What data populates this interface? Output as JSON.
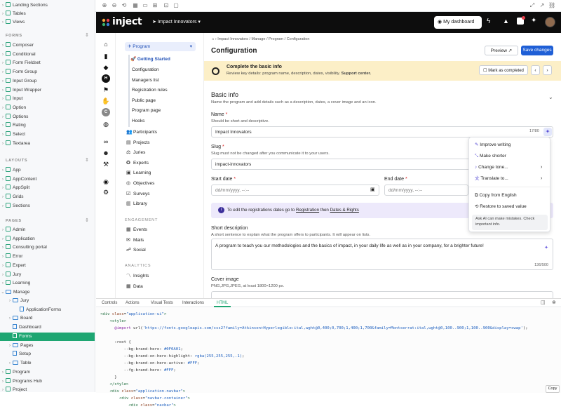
{
  "tree": {
    "top_items": [
      "Landing Sections",
      "Tables",
      "Views"
    ],
    "forms_label": "FORMS",
    "forms": [
      "Composer",
      "Conditional",
      "Form Fieldset",
      "Form Group",
      "Input Group",
      "Input Wrapper",
      "Input",
      "Option",
      "Options",
      "Rating",
      "Select",
      "Textarea"
    ],
    "layouts_label": "LAYOUTS",
    "layouts": [
      "App",
      "AppContent",
      "AppSplit",
      "Grids",
      "Sections"
    ],
    "pages_label": "PAGES",
    "pages": [
      "Admin",
      "Application",
      "Consulting portal",
      "Error",
      "Expert",
      "Jury",
      "Learning"
    ],
    "manage": "Manage",
    "manage_children": [
      "Jury",
      "ApplicationForms",
      "Board",
      "Dashboard",
      "Forms",
      "Pages",
      "Setup",
      "Table"
    ],
    "after": [
      "Program",
      "Programs Hub",
      "Project"
    ]
  },
  "navbar": {
    "brand": "inject",
    "program": "Impact Innovators",
    "dashboard": "My dashboard"
  },
  "menu": {
    "program": "Program",
    "getting_started": "🚀 Getting Started",
    "sub": [
      "Configuration",
      "Managers list",
      "Registration rules",
      "Public page",
      "Program page",
      "Hooks"
    ],
    "items": [
      "Participants",
      "Projects",
      "Juries",
      "Experts",
      "Learning",
      "Objectives",
      "Surveys",
      "Library"
    ],
    "engagement_label": "ENGAGEMENT",
    "engagement": [
      "Events",
      "Mails",
      "Social"
    ],
    "analytics_label": "ANALYTICS",
    "analytics": [
      "Insights",
      "Data"
    ]
  },
  "breadcrumb": [
    "Impact Innovators",
    "Manage",
    "Program",
    "Configuration"
  ],
  "page_title": "Configuration",
  "preview_label": "Preview",
  "save_label": "Save changes",
  "banner": {
    "title": "Complete the basic info",
    "text": "Review key details: program name, description, dates, visibility.",
    "link": "Support center.",
    "mark": "Mark as completed"
  },
  "basic": {
    "title": "Basic info",
    "subtitle": "Name the program and add details such as a description, dates, a cover image and an icon.",
    "name_label": "Name",
    "name_help": "Should be short and descriptive.",
    "name_value": "Impact Innovators",
    "name_count": "17/80",
    "slug_label": "Slug",
    "slug_help": "Slug must not be changed after you communicate it to your users.",
    "slug_value": "impact-innovators",
    "start_label": "Start date",
    "end_label": "End date",
    "date_placeholder": "dd/mm/yyyy, --:--",
    "info_text": "To edit the registrations dates go to",
    "info_link1": "Registration",
    "info_then": "then",
    "info_link2": "Dates & Rights",
    "desc_label": "Short description",
    "desc_help": "A short sentence to explain what the program offers to participants. It will appear on lists.",
    "desc_value": "A program to teach you our methodologies and the basics of impact, in your daily life as well as in your company, for a brighter future!",
    "desc_count": "136/500",
    "cover_label": "Cover image",
    "cover_help": "PNG,JPG,JPEG, at least 1800×1200 px."
  },
  "ai_menu": {
    "items": [
      "Improve writing",
      "Make shorter",
      "Change tone...",
      "Translate to..."
    ],
    "items2": [
      "Copy from English",
      "Restore to saved value"
    ],
    "warning": "Ask AI can make mistakes. Check important info."
  },
  "panel": {
    "tabs": [
      "Controls",
      "Actions",
      "Visual Tests",
      "Interactions",
      "HTML"
    ],
    "copy": "Copy"
  },
  "colors": {
    "brand": "#0F0A01",
    "accent": "#1ea672",
    "link": "#1d5fbf"
  }
}
